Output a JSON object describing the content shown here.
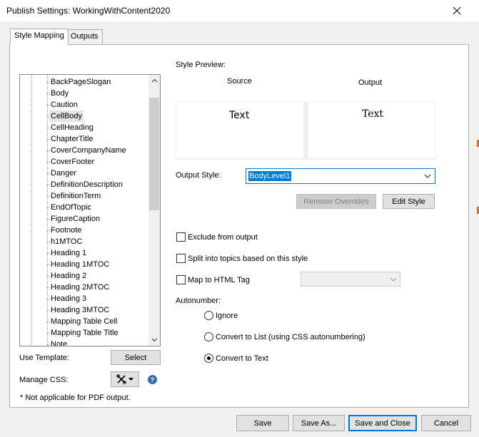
{
  "window": {
    "title": "Publish Settings: WorkingWithContent2020"
  },
  "tabs": [
    {
      "label": "Style Mapping",
      "active": true
    },
    {
      "label": "Outputs",
      "active": false
    }
  ],
  "style_list": {
    "items": [
      "BackPageSlogan",
      "Body",
      "Caution",
      "CellBody",
      "CellHeading",
      "ChapterTitle",
      "CoverCompanyName",
      "CoverFooter",
      "Danger",
      "DefinitionDescription",
      "DefinitionTerm",
      "EndOfTopic",
      "FigureCaption",
      "Footnote",
      "h1MTOC",
      "Heading 1",
      "Heading 1MTOC",
      "Heading 2",
      "Heading 2MTOC",
      "Heading 3",
      "Heading 3MTOC",
      "Mapping Table Cell",
      "Mapping Table Title",
      "Note"
    ],
    "selected": "CellBody"
  },
  "left_controls": {
    "use_template_label": "Use Template:",
    "select_button": "Select",
    "manage_css_label": "Manage CSS:",
    "help_glyph": "?",
    "footnote": "* Not applicable for PDF output."
  },
  "preview": {
    "heading": "Style Preview:",
    "source_label": "Source",
    "output_label": "Output",
    "source_text": "Text",
    "output_text": "Text"
  },
  "output_style": {
    "label": "Output Style:",
    "value": "BodyLevel1"
  },
  "buttons": {
    "remove_overrides": "Remove Overrides",
    "edit_style": "Edit Style",
    "save": "Save",
    "save_as": "Save As...",
    "save_and_close": "Save and Close",
    "cancel": "Cancel"
  },
  "options": {
    "exclude_label": "Exclude from output",
    "exclude_checked": false,
    "split_label": "Split into topics based on this style",
    "split_checked": false,
    "map_html_label": "Map to HTML Tag",
    "map_html_checked": false
  },
  "autonumber": {
    "label": "Autonumber:",
    "options": [
      {
        "label": "Ignore",
        "checked": false
      },
      {
        "label": "Convert to List (using CSS autonumbering)",
        "checked": false
      },
      {
        "label": "Convert to Text",
        "checked": true
      }
    ]
  },
  "colors": {
    "accent": "#0078d7",
    "help_icon": "#2e6db4"
  }
}
